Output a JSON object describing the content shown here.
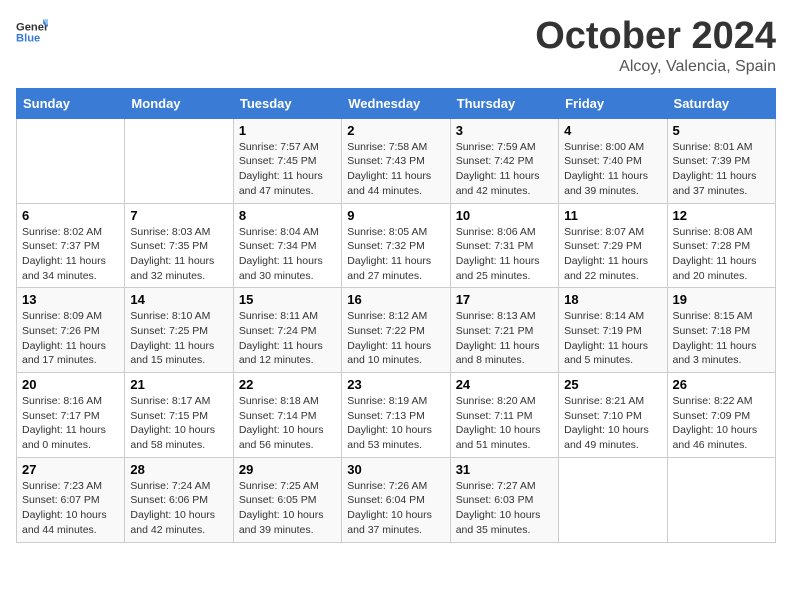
{
  "header": {
    "logo_general": "General",
    "logo_blue": "Blue",
    "title": "October 2024",
    "subtitle": "Alcoy, Valencia, Spain"
  },
  "weekdays": [
    "Sunday",
    "Monday",
    "Tuesday",
    "Wednesday",
    "Thursday",
    "Friday",
    "Saturday"
  ],
  "weeks": [
    [
      {
        "day": "",
        "info": ""
      },
      {
        "day": "",
        "info": ""
      },
      {
        "day": "1",
        "info": "Sunrise: 7:57 AM\nSunset: 7:45 PM\nDaylight: 11 hours and 47 minutes."
      },
      {
        "day": "2",
        "info": "Sunrise: 7:58 AM\nSunset: 7:43 PM\nDaylight: 11 hours and 44 minutes."
      },
      {
        "day": "3",
        "info": "Sunrise: 7:59 AM\nSunset: 7:42 PM\nDaylight: 11 hours and 42 minutes."
      },
      {
        "day": "4",
        "info": "Sunrise: 8:00 AM\nSunset: 7:40 PM\nDaylight: 11 hours and 39 minutes."
      },
      {
        "day": "5",
        "info": "Sunrise: 8:01 AM\nSunset: 7:39 PM\nDaylight: 11 hours and 37 minutes."
      }
    ],
    [
      {
        "day": "6",
        "info": "Sunrise: 8:02 AM\nSunset: 7:37 PM\nDaylight: 11 hours and 34 minutes."
      },
      {
        "day": "7",
        "info": "Sunrise: 8:03 AM\nSunset: 7:35 PM\nDaylight: 11 hours and 32 minutes."
      },
      {
        "day": "8",
        "info": "Sunrise: 8:04 AM\nSunset: 7:34 PM\nDaylight: 11 hours and 30 minutes."
      },
      {
        "day": "9",
        "info": "Sunrise: 8:05 AM\nSunset: 7:32 PM\nDaylight: 11 hours and 27 minutes."
      },
      {
        "day": "10",
        "info": "Sunrise: 8:06 AM\nSunset: 7:31 PM\nDaylight: 11 hours and 25 minutes."
      },
      {
        "day": "11",
        "info": "Sunrise: 8:07 AM\nSunset: 7:29 PM\nDaylight: 11 hours and 22 minutes."
      },
      {
        "day": "12",
        "info": "Sunrise: 8:08 AM\nSunset: 7:28 PM\nDaylight: 11 hours and 20 minutes."
      }
    ],
    [
      {
        "day": "13",
        "info": "Sunrise: 8:09 AM\nSunset: 7:26 PM\nDaylight: 11 hours and 17 minutes."
      },
      {
        "day": "14",
        "info": "Sunrise: 8:10 AM\nSunset: 7:25 PM\nDaylight: 11 hours and 15 minutes."
      },
      {
        "day": "15",
        "info": "Sunrise: 8:11 AM\nSunset: 7:24 PM\nDaylight: 11 hours and 12 minutes."
      },
      {
        "day": "16",
        "info": "Sunrise: 8:12 AM\nSunset: 7:22 PM\nDaylight: 11 hours and 10 minutes."
      },
      {
        "day": "17",
        "info": "Sunrise: 8:13 AM\nSunset: 7:21 PM\nDaylight: 11 hours and 8 minutes."
      },
      {
        "day": "18",
        "info": "Sunrise: 8:14 AM\nSunset: 7:19 PM\nDaylight: 11 hours and 5 minutes."
      },
      {
        "day": "19",
        "info": "Sunrise: 8:15 AM\nSunset: 7:18 PM\nDaylight: 11 hours and 3 minutes."
      }
    ],
    [
      {
        "day": "20",
        "info": "Sunrise: 8:16 AM\nSunset: 7:17 PM\nDaylight: 11 hours and 0 minutes."
      },
      {
        "day": "21",
        "info": "Sunrise: 8:17 AM\nSunset: 7:15 PM\nDaylight: 10 hours and 58 minutes."
      },
      {
        "day": "22",
        "info": "Sunrise: 8:18 AM\nSunset: 7:14 PM\nDaylight: 10 hours and 56 minutes."
      },
      {
        "day": "23",
        "info": "Sunrise: 8:19 AM\nSunset: 7:13 PM\nDaylight: 10 hours and 53 minutes."
      },
      {
        "day": "24",
        "info": "Sunrise: 8:20 AM\nSunset: 7:11 PM\nDaylight: 10 hours and 51 minutes."
      },
      {
        "day": "25",
        "info": "Sunrise: 8:21 AM\nSunset: 7:10 PM\nDaylight: 10 hours and 49 minutes."
      },
      {
        "day": "26",
        "info": "Sunrise: 8:22 AM\nSunset: 7:09 PM\nDaylight: 10 hours and 46 minutes."
      }
    ],
    [
      {
        "day": "27",
        "info": "Sunrise: 7:23 AM\nSunset: 6:07 PM\nDaylight: 10 hours and 44 minutes."
      },
      {
        "day": "28",
        "info": "Sunrise: 7:24 AM\nSunset: 6:06 PM\nDaylight: 10 hours and 42 minutes."
      },
      {
        "day": "29",
        "info": "Sunrise: 7:25 AM\nSunset: 6:05 PM\nDaylight: 10 hours and 39 minutes."
      },
      {
        "day": "30",
        "info": "Sunrise: 7:26 AM\nSunset: 6:04 PM\nDaylight: 10 hours and 37 minutes."
      },
      {
        "day": "31",
        "info": "Sunrise: 7:27 AM\nSunset: 6:03 PM\nDaylight: 10 hours and 35 minutes."
      },
      {
        "day": "",
        "info": ""
      },
      {
        "day": "",
        "info": ""
      }
    ]
  ]
}
